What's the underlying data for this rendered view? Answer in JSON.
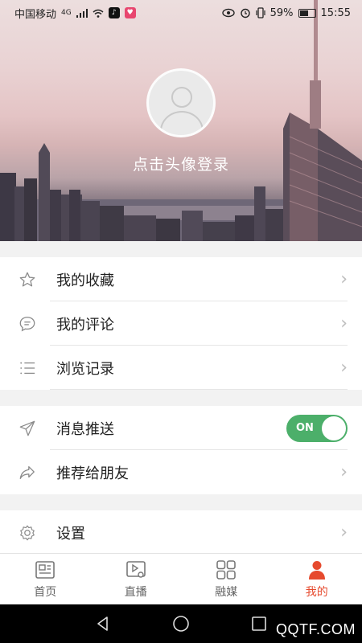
{
  "status": {
    "carrier": "中国移动",
    "network": "4G",
    "battery": "59%",
    "battery_level": 0.59,
    "time": "15:55"
  },
  "header": {
    "login_prompt": "点击头像登录"
  },
  "menu": {
    "group1": [
      {
        "label": "我的收藏",
        "icon": "star-icon"
      },
      {
        "label": "我的评论",
        "icon": "comment-icon"
      },
      {
        "label": "浏览记录",
        "icon": "list-icon"
      }
    ],
    "group2": [
      {
        "label": "消息推送",
        "icon": "send-icon",
        "toggle": "ON"
      },
      {
        "label": "推荐给朋友",
        "icon": "share-icon"
      }
    ],
    "group3": [
      {
        "label": "设置",
        "icon": "gear-icon"
      }
    ]
  },
  "tabs": [
    {
      "label": "首页",
      "icon": "news-icon",
      "active": false
    },
    {
      "label": "直播",
      "icon": "video-icon",
      "active": false
    },
    {
      "label": "融媒",
      "icon": "grid-icon",
      "active": false
    },
    {
      "label": "我的",
      "icon": "person-icon",
      "active": true
    }
  ],
  "watermark": "QQTF.COM",
  "colors": {
    "accent": "#e64a2e",
    "toggle_on": "#4caf6a"
  }
}
